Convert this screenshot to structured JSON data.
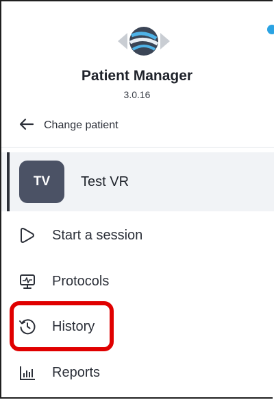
{
  "app": {
    "title": "Patient Manager",
    "version": "3.0.16"
  },
  "change_patient": {
    "label": "Change patient",
    "icon": "arrow-left-icon"
  },
  "patient": {
    "initials": "TV",
    "name": "Test VR",
    "active": true
  },
  "nav": {
    "items": [
      {
        "label": "Start a session",
        "icon": "play-icon"
      },
      {
        "label": "Protocols",
        "icon": "monitor-pulse-icon"
      },
      {
        "label": "History",
        "icon": "history-icon",
        "highlighted": true
      },
      {
        "label": "Reports",
        "icon": "bar-chart-icon"
      }
    ]
  },
  "colors": {
    "avatar_bg": "#4b5265",
    "selected_row_bg": "#f1f3f6",
    "highlight": "#e00000",
    "accent_dot": "#2aa3e3"
  }
}
